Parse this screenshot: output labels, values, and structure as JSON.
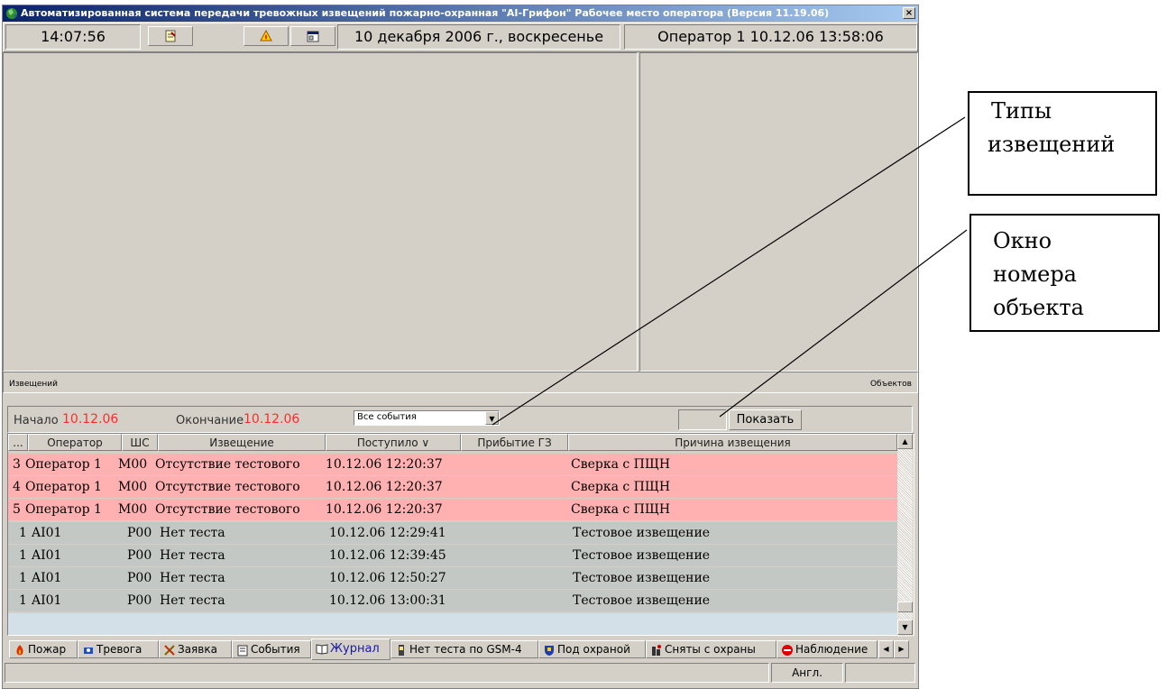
{
  "window": {
    "title": "Автоматизированная система передачи тревожных извещений пожарно-охранная \"AI-Грифон\" Рабочее место оператора (Версия 11.19.06)",
    "close_label": "×"
  },
  "toolbar": {
    "time": "14:07:56",
    "date": "10 декабря 2006 г., воскресенье",
    "operator": "Оператор 1  10.12.06 13:58:06",
    "icons": [
      "note-icon",
      "fire-alarm-icon",
      "properties-icon"
    ]
  },
  "strip": {
    "left": "Извещений",
    "right": "Объектов"
  },
  "filter": {
    "start_label": "Начало",
    "start_value": "10.12.06",
    "end_label": "Окончание",
    "end_value": "10.12.06",
    "type_value": "Все события",
    "object_value": "",
    "show_button": "Показать",
    "value_color": "#ff2a2a"
  },
  "table": {
    "columns": [
      "...",
      "Оператор",
      "ШС",
      "Извещение",
      "Поступило ∨",
      "Прибытие ГЗ",
      "Причина извещения"
    ],
    "rows": [
      {
        "style": "pink",
        "num": "3",
        "operator": "Оператор 1",
        "zone": "M00",
        "event": "Отсутствие тестового",
        "received": "10.12.06 12:20:37",
        "arrival": "",
        "reason": "Сверка с ПЩН"
      },
      {
        "style": "pink",
        "num": "4",
        "operator": "Оператор 1",
        "zone": "M00",
        "event": "Отсутствие тестового",
        "received": "10.12.06 12:20:37",
        "arrival": "",
        "reason": "Сверка с ПЩН"
      },
      {
        "style": "pink",
        "num": "5",
        "operator": "Оператор 1",
        "zone": "M00",
        "event": "Отсутствие тестового",
        "received": "10.12.06 12:20:37",
        "arrival": "",
        "reason": "Сверка с ПЩН"
      },
      {
        "style": "gray",
        "num": "1",
        "operator": "AI01",
        "zone": "P00",
        "event": "Нет теста",
        "received": "10.12.06 12:29:41",
        "arrival": "",
        "reason": "Тестовое извещение"
      },
      {
        "style": "gray",
        "num": "1",
        "operator": "AI01",
        "zone": "P00",
        "event": "Нет теста",
        "received": "10.12.06 12:39:45",
        "arrival": "",
        "reason": "Тестовое извещение"
      },
      {
        "style": "gray",
        "num": "1",
        "operator": "AI01",
        "zone": "P00",
        "event": "Нет теста",
        "received": "10.12.06 12:50:27",
        "arrival": "",
        "reason": "Тестовое извещение"
      },
      {
        "style": "gray",
        "num": "1",
        "operator": "AI01",
        "zone": "P00",
        "event": "Нет теста",
        "received": "10.12.06 13:00:31",
        "arrival": "",
        "reason": "Тестовое извещение"
      }
    ],
    "colors": {
      "pink": "#ffb0b0",
      "gray": "#c4c8c4"
    }
  },
  "tabs": [
    {
      "label": "Пожар",
      "icon": "fire-icon"
    },
    {
      "label": "Тревога",
      "icon": "alarm-icon"
    },
    {
      "label": "Заявка",
      "icon": "tools-icon"
    },
    {
      "label": "События",
      "icon": "events-icon"
    },
    {
      "label": "Журнал",
      "icon": "journal-icon",
      "active": true
    },
    {
      "label": "Нет теста по GSM-4",
      "icon": "phone-icon"
    },
    {
      "label": "Под охраной",
      "icon": "shield-icon"
    },
    {
      "label": "Сняты с охраны",
      "icon": "unguarded-icon"
    },
    {
      "label": "Наблюдение",
      "icon": "stop-icon"
    }
  ],
  "statusbar": {
    "lang": "Англ."
  },
  "callouts": {
    "types": [
      "Типы",
      "извещений"
    ],
    "object": [
      "Окно",
      "номера",
      "объекта"
    ]
  }
}
